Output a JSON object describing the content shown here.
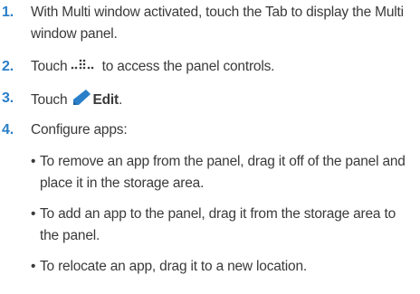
{
  "steps": [
    {
      "number": "1.",
      "text": "With Multi window activated, touch the Tab to display the Multi window panel."
    },
    {
      "number": "2.",
      "before": "Touch",
      "icon": "panel-controls-dots-icon",
      "after": "to access the panel controls."
    },
    {
      "number": "3.",
      "before": "Touch",
      "icon": "pencil-icon",
      "bold": "Edit",
      "after": "."
    },
    {
      "number": "4.",
      "text": "Configure apps:",
      "bullets": [
        "To remove an app from the panel, drag it off of the panel and place it in the storage area.",
        "To add an app to the panel, drag it from the storage area to the panel.",
        "To relocate an app, drag it to a new location."
      ]
    }
  ],
  "colors": {
    "step_number": "#2a7fc8",
    "body_text": "#3a3a3a",
    "pencil": "#2a7fc8"
  }
}
